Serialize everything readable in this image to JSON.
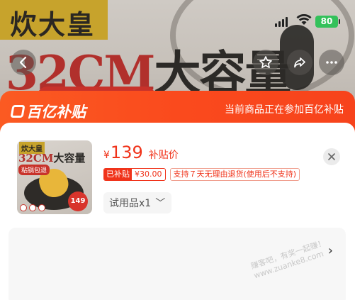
{
  "status_bar": {
    "time": "",
    "battery": "80"
  },
  "banner": {
    "brand": "炊大皇",
    "headline_red": "32CM",
    "headline_dark": "大容量"
  },
  "icons": {
    "back": "chevron-left-icon",
    "favorite": "star-icon",
    "share": "share-icon",
    "more": "more-icon",
    "close": "close-icon"
  },
  "subsidy": {
    "logo_text": "百亿补贴",
    "note": "当前商品正在参加百亿补贴",
    "accent": "#fa4a1d"
  },
  "product": {
    "thumb_brand": "炊大皇",
    "thumb_headline_red": "32CM",
    "thumb_headline_dark": "大容量",
    "thumb_tag": "粘锅包退",
    "thumb_price": "149",
    "price_symbol": "¥",
    "price": "139",
    "price_label": "补贴价",
    "subsidy_tag_label": "已补贴",
    "subsidy_tag_value": "¥30.00",
    "return_tag": "支持７天无理由退货(使用后不支持)",
    "variant_label": "试用品x1",
    "variant_chevron": "﹀",
    "price_color": "#f0331a"
  },
  "option_panel": {
    "chevron": "›"
  },
  "watermark": {
    "line1": "赚客吧，有奖一起赚！",
    "line2": "www.zuanke8.com"
  }
}
